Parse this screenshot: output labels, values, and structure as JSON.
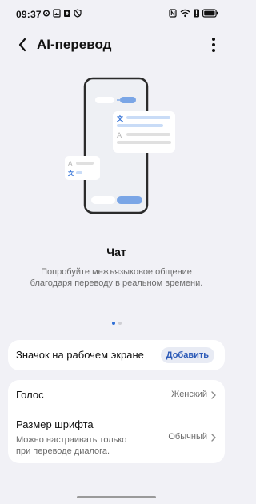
{
  "status_bar": {
    "time": "09:37",
    "left_icons": [
      "gear-icon",
      "image-icon",
      "upload-icon",
      "shield-icon"
    ],
    "right_icons": [
      "nfc-icon",
      "wifi-icon",
      "alert-icon",
      "battery-icon"
    ]
  },
  "header": {
    "title": "AI-перевод",
    "back_icon": "back-arrow-icon",
    "more_icon": "more-vert-icon"
  },
  "feature_slide": {
    "title": "Чат",
    "description": "Попробуйте межъязыковое общение благодаря переводу в реальном времени.",
    "page_count": 2,
    "active_page": 1,
    "glyph_translate": "文",
    "glyph_a": "A"
  },
  "shortcut_card": {
    "label": "Значок на рабочем экране",
    "button_label": "Добавить"
  },
  "settings": {
    "voice": {
      "label": "Голос",
      "value": "Женский"
    },
    "font_size": {
      "label": "Размер шрифта",
      "sublabel_line1": "Можно настраивать только",
      "sublabel_line2": "при переводе диалога.",
      "value": "Обычный"
    }
  },
  "colors": {
    "accent": "#2f6fd6",
    "background": "#f1f1f6",
    "card": "#ffffff",
    "button_bg": "#e8ebf4",
    "button_text": "#2d5bb8"
  }
}
